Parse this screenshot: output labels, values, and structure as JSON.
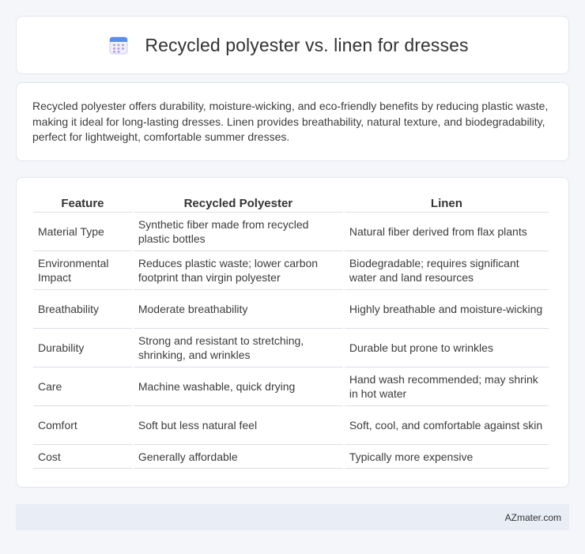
{
  "header": {
    "title": "Recycled polyester vs. linen for dresses",
    "icon": "calendar-icon"
  },
  "intro": {
    "text": "Recycled polyester offers durability, moisture-wicking, and eco-friendly benefits by reducing plastic waste, making it ideal for long-lasting dresses. Linen provides breathability, natural texture, and biodegradability, perfect for lightweight, comfortable summer dresses."
  },
  "table": {
    "headers": [
      "Feature",
      "Recycled Polyester",
      "Linen"
    ],
    "rows": [
      [
        "Material Type",
        "Synthetic fiber made from recycled plastic bottles",
        "Natural fiber derived from flax plants"
      ],
      [
        "Environmental Impact",
        "Reduces plastic waste; lower carbon footprint than virgin polyester",
        "Biodegradable; requires significant water and land resources"
      ],
      [
        "Breathability",
        "Moderate breathability",
        "Highly breathable and moisture-wicking"
      ],
      [
        "Durability",
        "Strong and resistant to stretching, shrinking, and wrinkles",
        "Durable but prone to wrinkles"
      ],
      [
        "Care",
        "Machine washable, quick drying",
        "Hand wash recommended; may shrink in hot water"
      ],
      [
        "Comfort",
        "Soft but less natural feel",
        "Soft, cool, and comfortable against skin"
      ],
      [
        "Cost",
        "Generally affordable",
        "Typically more expensive"
      ]
    ]
  },
  "footer": {
    "brand": "AZmater.com"
  }
}
